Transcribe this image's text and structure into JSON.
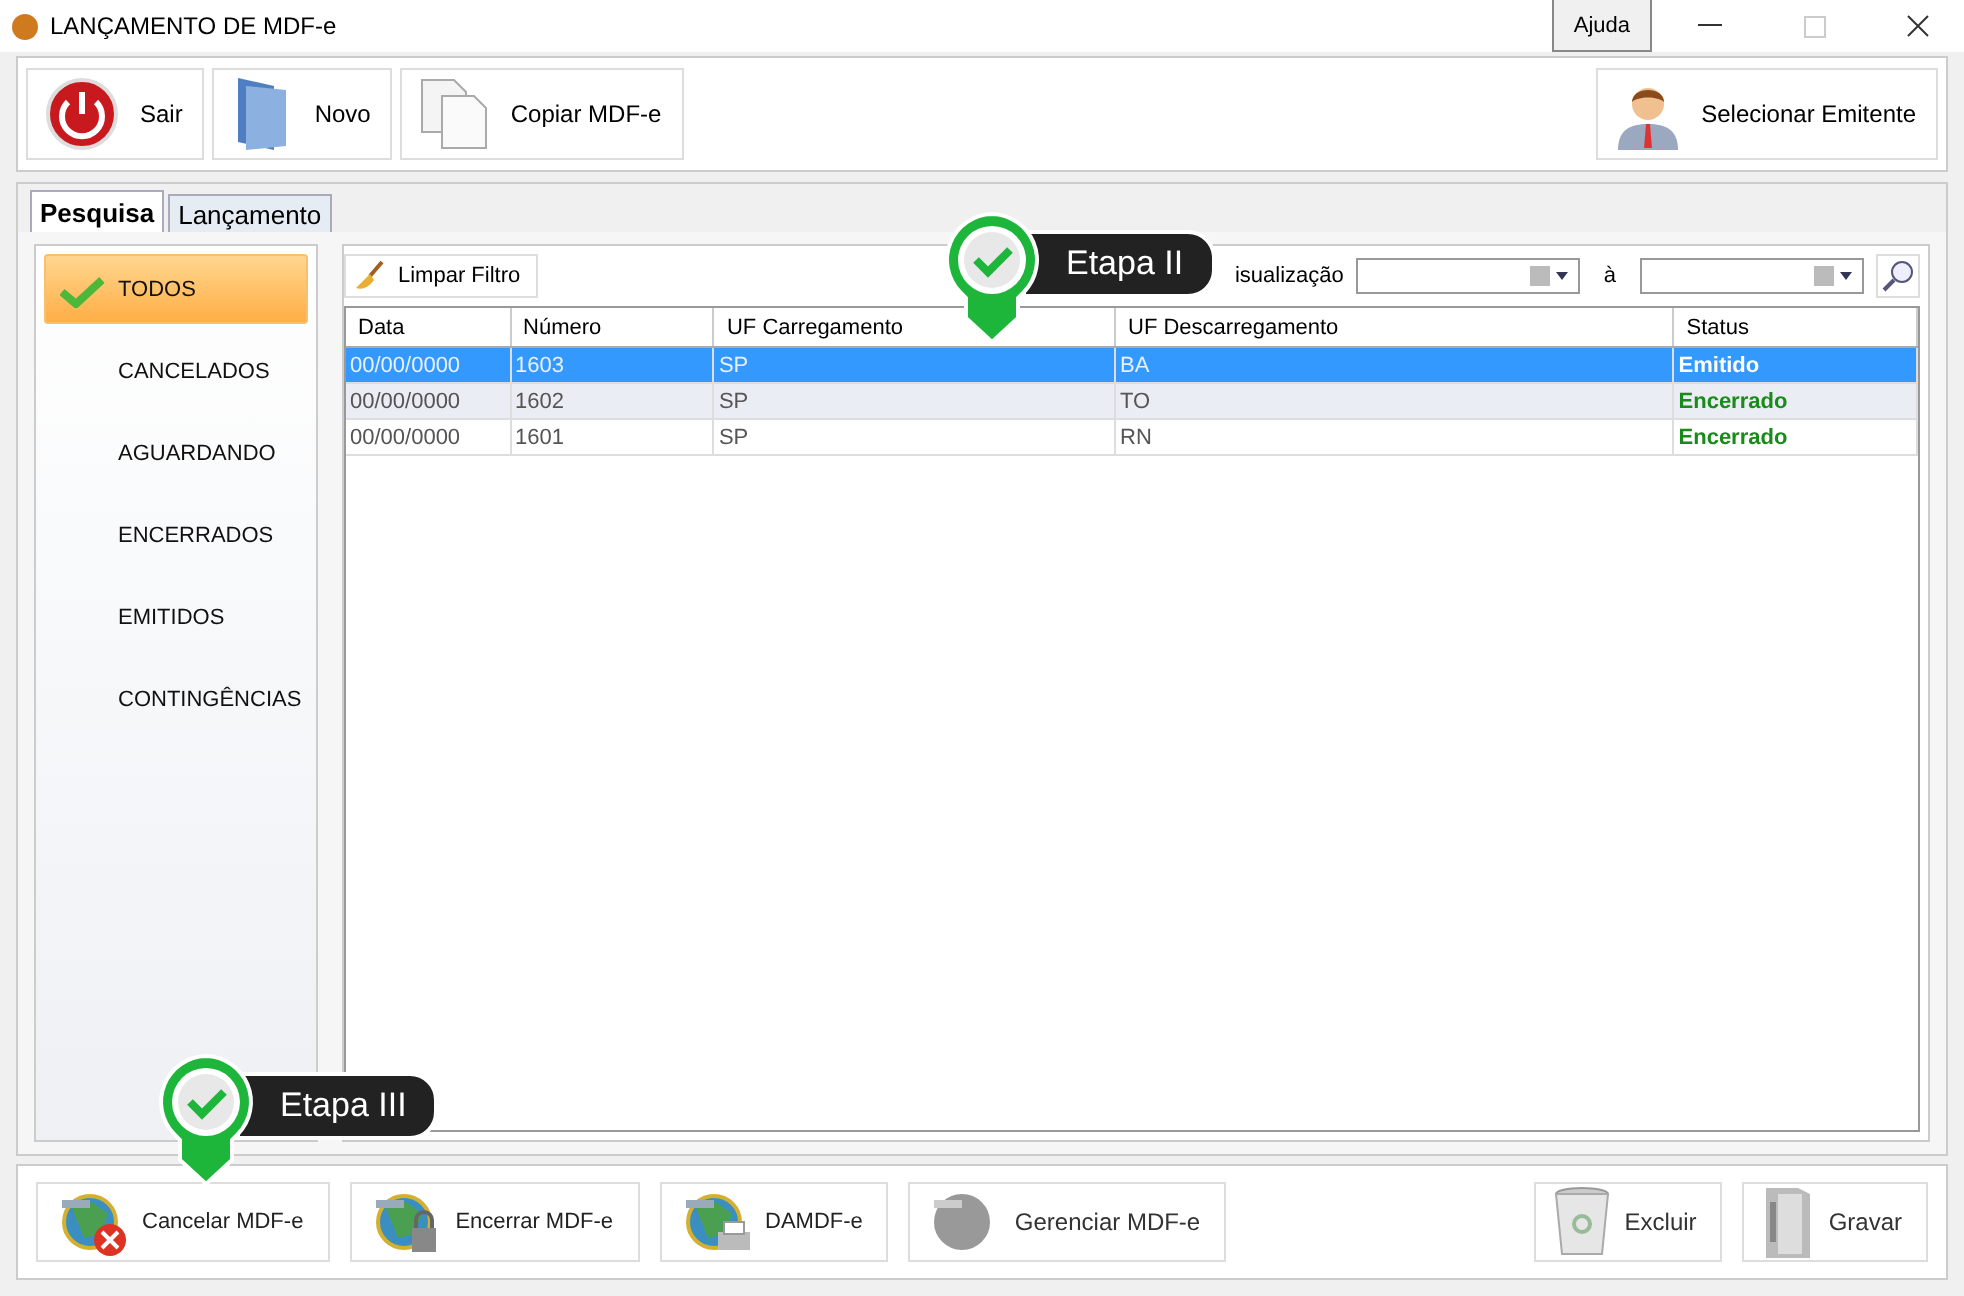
{
  "window": {
    "title": "LANÇAMENTO DE MDF-e",
    "help_button": "Ajuda"
  },
  "toolbar": {
    "left": [
      {
        "label": "Sair",
        "kind": "power"
      },
      {
        "label": "Novo",
        "kind": "folder"
      },
      {
        "label": "Copiar MDF-e",
        "kind": "copy"
      }
    ],
    "right": [
      {
        "label": "Selecionar Emitente",
        "kind": "person"
      }
    ]
  },
  "tabs": [
    {
      "label": "Pesquisa",
      "selected": true
    },
    {
      "label": "Lançamento",
      "selected": false
    }
  ],
  "sidebar": {
    "items": [
      {
        "label": "TODOS",
        "selected": true
      },
      {
        "label": "CANCELADOS",
        "selected": false
      },
      {
        "label": "AGUARDANDO",
        "selected": false
      },
      {
        "label": "ENCERRADOS",
        "selected": false
      },
      {
        "label": "EMITIDOS",
        "selected": false
      },
      {
        "label": "CONTINGÊNCIAS",
        "selected": false
      }
    ]
  },
  "filter": {
    "clear_button": "Limpar Filtro",
    "date_label": "isualização",
    "range_separator": "à"
  },
  "table": {
    "columns": [
      "Data",
      "Número",
      "UF Carregamento",
      "UF Descarregamento",
      "Status"
    ],
    "rows": [
      {
        "cells": [
          "00/00/0000",
          "1603",
          "SP",
          "BA",
          "Emitido"
        ],
        "selected": true
      },
      {
        "cells": [
          "00/00/0000",
          "1602",
          "SP",
          "TO",
          "Encerrado"
        ],
        "selected": false
      },
      {
        "cells": [
          "00/00/0000",
          "1601",
          "SP",
          "RN",
          "Encerrado"
        ],
        "selected": false
      }
    ]
  },
  "bottom_bar": {
    "left": [
      {
        "label": "Cancelar MDF-e",
        "kind": "cancel",
        "disabled": false
      },
      {
        "label": "Encerrar MDF-e",
        "kind": "lock",
        "disabled": false
      },
      {
        "label": "DAMDF-e",
        "kind": "print",
        "disabled": false
      },
      {
        "label": "Gerenciar MDF-e",
        "kind": "map",
        "disabled": true
      }
    ],
    "right": [
      {
        "label": "Excluir",
        "kind": "trash",
        "disabled": true
      },
      {
        "label": "Gravar",
        "kind": "binder",
        "disabled": true
      }
    ]
  },
  "callouts": [
    {
      "label": "Etapa II"
    },
    {
      "label": "Etapa III"
    }
  ]
}
